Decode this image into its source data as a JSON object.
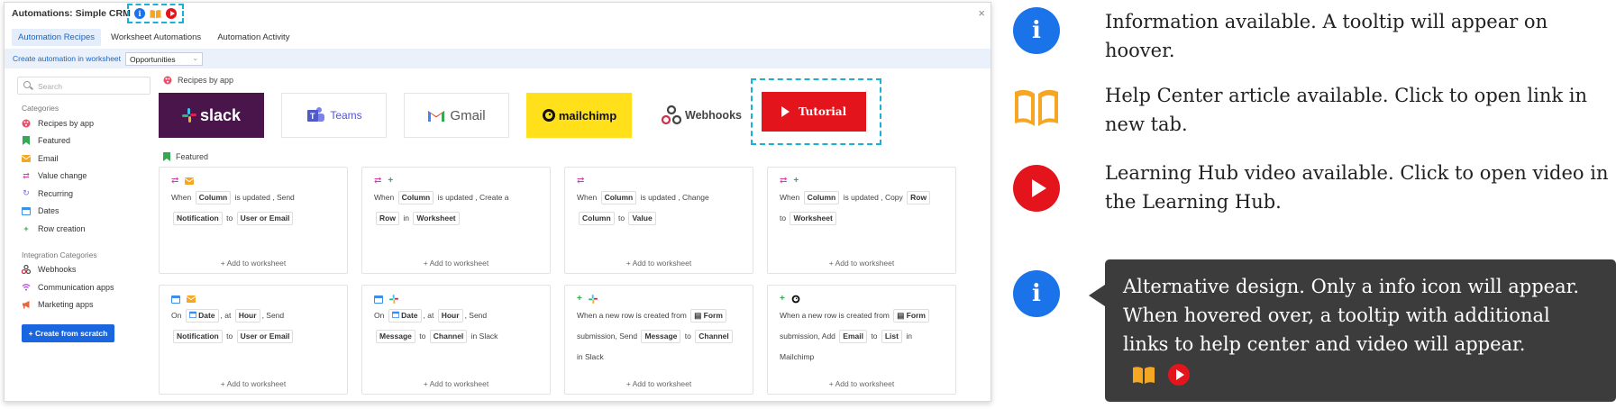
{
  "dialog": {
    "title": "Automations: Simple CRM",
    "close": "×",
    "tabs": [
      {
        "label": "Automation Recipes"
      },
      {
        "label": "Worksheet Automations"
      },
      {
        "label": "Automation Activity"
      }
    ],
    "subbar": {
      "label": "Create automation in worksheet",
      "worksheet_value": "Opportunities"
    }
  },
  "sidebar": {
    "search_placeholder": "Search",
    "categories_title": "Categories",
    "categories": [
      {
        "label": "Recipes by app",
        "icon": "palette-icon"
      },
      {
        "label": "Featured",
        "icon": "bookmark-icon"
      },
      {
        "label": "Email",
        "icon": "envelope-icon"
      },
      {
        "label": "Value change",
        "icon": "swap-icon"
      },
      {
        "label": "Recurring",
        "icon": "recurring-icon"
      },
      {
        "label": "Dates",
        "icon": "calendar-icon"
      },
      {
        "label": "Row creation",
        "icon": "plus-icon"
      }
    ],
    "integration_title": "Integration Categories",
    "integrations": [
      {
        "label": "Webhooks",
        "icon": "webhooks-icon"
      },
      {
        "label": "Communication apps",
        "icon": "wifi-icon"
      },
      {
        "label": "Marketing apps",
        "icon": "megaphone-icon"
      }
    ],
    "create_button": "+ Create from scratch"
  },
  "main": {
    "recipes_title": "Recipes by app",
    "apps": [
      {
        "label": "slack"
      },
      {
        "label": "Teams"
      },
      {
        "label": "Gmail"
      },
      {
        "label": "mailchimp"
      },
      {
        "label": "Webhooks"
      }
    ],
    "tutorial_label": "Tutorial",
    "featured_title": "Featured",
    "add_label": "+ Add to worksheet",
    "cards": [
      {
        "w": [
          "When",
          "is updated ,",
          "Send",
          "to"
        ],
        "c": [
          "Column",
          "Notification",
          "User or Email"
        ]
      },
      {
        "w": [
          "When",
          "is updated ,",
          "Create a",
          "in"
        ],
        "c": [
          "Column",
          "Row",
          "Worksheet"
        ]
      },
      {
        "w": [
          "When",
          "is updated ,",
          "Change",
          "to"
        ],
        "c": [
          "Column",
          "Column",
          "Value"
        ]
      },
      {
        "w": [
          "When",
          "is updated ,",
          "Copy",
          "to"
        ],
        "c": [
          "Column",
          "Row",
          "Worksheet"
        ]
      },
      {
        "w": [
          "On",
          ", at",
          ", Send",
          "to"
        ],
        "c": [
          "Date",
          "Hour",
          "Notification",
          "User or Email"
        ]
      },
      {
        "w": [
          "On",
          ", at",
          ", Send",
          "to",
          "in Slack"
        ],
        "c": [
          "Date",
          "Hour",
          "Message",
          "Channel"
        ]
      },
      {
        "w": [
          "When a new row is created from",
          "submission, Send",
          "to",
          "in Slack"
        ],
        "c": [
          "Form",
          "Message",
          "Channel"
        ]
      },
      {
        "w": [
          "When a new row is created from",
          "submission, Add",
          "to",
          "in",
          "Mailchimp"
        ],
        "c": [
          "Form",
          "Email",
          "List"
        ]
      }
    ]
  },
  "legend": [
    {
      "text": "Information available. A tooltip will appear on hoover."
    },
    {
      "text": "Help Center article available. Click to open link in new tab."
    },
    {
      "text": "Learning Hub video available. Click to open video in the Learning Hub."
    }
  ],
  "tooltip": {
    "text": "Alternative design. Only a info icon will appear. When hovered over, a tooltip with additional links to help center and video will appear."
  },
  "colors": {
    "accent": "#1a66e0",
    "slack": "#4a154b",
    "mailchimp": "#ffe01b",
    "tutorial": "#e3141b",
    "highlight": "#1ab0d8",
    "book": "#f5a623"
  }
}
